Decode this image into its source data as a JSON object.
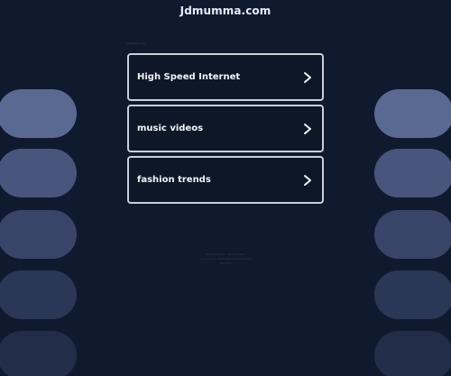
{
  "header": {
    "site_title": "Jdmumma.com"
  },
  "related_searches": {
    "heading": "Related Links",
    "items": [
      {
        "label": "High Speed Internet",
        "icon": "chevron-right-icon"
      },
      {
        "label": "music videos",
        "icon": "chevron-right-icon"
      },
      {
        "label": "fashion trends",
        "icon": "chevron-right-icon"
      }
    ]
  },
  "footer": {
    "line1": "Privacy Policy · Terms of Use",
    "line2": "Copyright © 2023 All Rights Reserved",
    "line3": "Site Map"
  },
  "colors": {
    "background": "#101a2e",
    "link_border": "#c9ced8",
    "pill_top": "#5a6991",
    "pill_bottom": "#1f2a46"
  }
}
